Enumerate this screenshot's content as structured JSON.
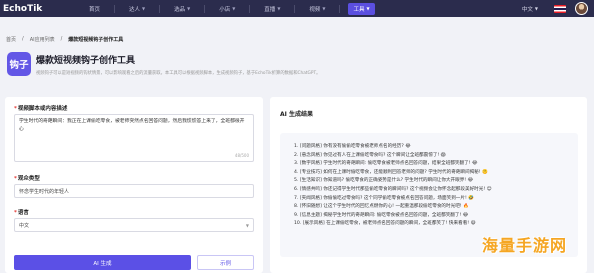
{
  "nav": {
    "logo": "EchoTik",
    "items": [
      {
        "label": "首页",
        "has_menu": false
      },
      {
        "label": "达人",
        "has_menu": true
      },
      {
        "label": "选品",
        "has_menu": true
      },
      {
        "label": "小店",
        "has_menu": true
      },
      {
        "label": "直播",
        "has_menu": true
      },
      {
        "label": "视频",
        "has_menu": true
      },
      {
        "label": "工具",
        "has_menu": true,
        "active": true
      }
    ],
    "language": "中文",
    "accent_color": "#5b4fe0"
  },
  "breadcrumb": [
    "首页",
    "AI应用列表",
    "爆款短视频钩子创作工具"
  ],
  "header": {
    "icon_label": "钩子",
    "title": "爆款短视频钩子创作工具",
    "description": "视频钩子可以是短视频的钩状情景，可以影响观看之后的流量获取。本工具可以根据视频脚本，生成视频钩子，基于EchoTik折算的数据和ChatGPT。"
  },
  "form": {
    "script_label": "视频脚本或内容描述",
    "script_value": "学生时代的奇葩瞬间：我正在上课偷吃零食，被老师突然点名回答问题，然后我慌慌答上来了，全班都很开心",
    "char_count": "48/500",
    "audience_label": "观众类型",
    "audience_value": "怀念学生时代的年轻人",
    "language_label": "语言",
    "language_value": "中文",
    "generate_button": "AI 生成",
    "example_button": "示例"
  },
  "results": {
    "title": "AI 生成结果",
    "lines": [
      "1. [问题风格] 你有没有偷偷吃零食被老师点名的经历? 😂",
      "2. [悬念风格] 你见过有人在上课偷吃零食吗? 这个瞬间让全班都震惊了! 😱",
      "3. [数字风格] 学生时代的奇葩瞬间: 偷吃零食被老师点名回答问题，结果全班都笑翻了! 😂",
      "4. [专业技巧] 如何在上课时偷吃零食，还能顺利回答老师的问题? 学生时代的奇葩瞬间揭秘! 🤫",
      "5. [生活知识] 你知道吗? 偷吃零食的正确姿势是什么? 学生时代的瞬间让你大开眼界! 😂",
      "6. [情感共鸣] 你还记得学生时代那些偷吃零食的瞬间吗? 这个视频会让你怀念起那段美好时光! 😊",
      "7. [夹闻风格] 你偷偷吃过零食吗? 这个同学偷吃零食被点名回答问题，场面笑到一片! 🤣",
      "8. [怀旧随想] 让这个学生时代的回忆点燃你的心! 一起重温那段偷吃零食的时光吧! 🔥",
      "9. [信息主题] 揭秘学生时代的奇葩瞬间: 偷吃零食被点名回答问题，全班都笑翻了! 😂",
      "10. [展示风格] 在上课偷吃零食，被老师点名回答问题的瞬间，全班都笑了! 快来看看! 😄"
    ]
  },
  "watermark": "海量手游网"
}
